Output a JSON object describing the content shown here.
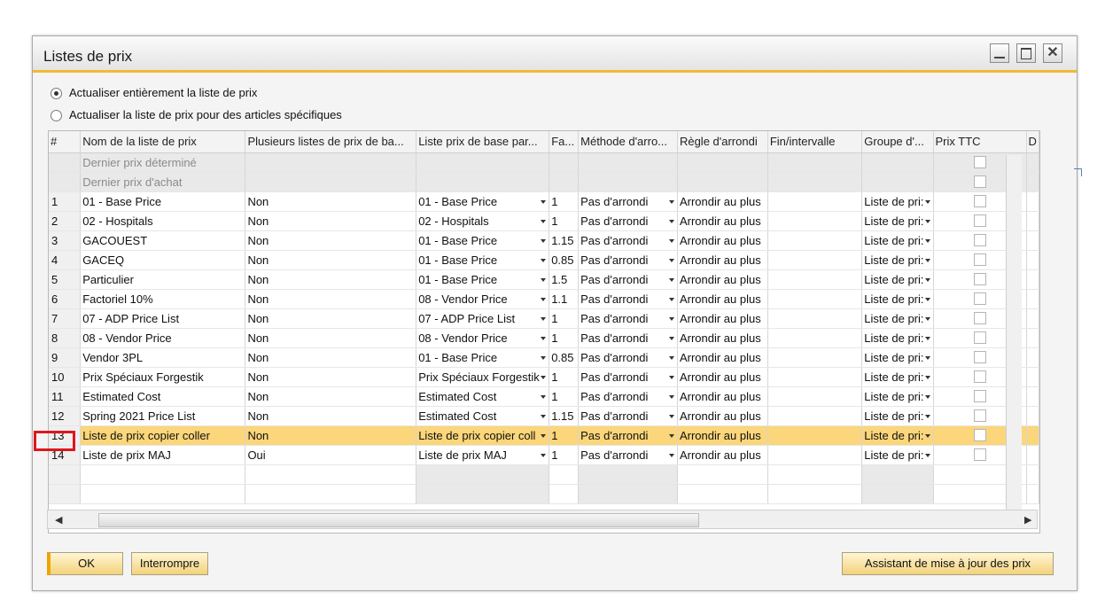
{
  "window": {
    "title": "Listes de prix"
  },
  "options": [
    {
      "label": "Actualiser entièrement la liste de prix",
      "selected": true
    },
    {
      "label": "Actualiser la liste de prix pour des articles spécifiques",
      "selected": false
    }
  ],
  "columns": [
    "#",
    "Nom de la liste de prix",
    "Plusieurs listes de prix de ba...",
    "Liste prix de base par...",
    "Fa...",
    "Méthode d'arro...",
    "Règle d'arrondi",
    "Fin/intervalle",
    "Groupe d'...",
    "Prix TTC",
    "D"
  ],
  "fixed_rows": [
    {
      "name": "Dernier prix déterminé"
    },
    {
      "name": "Dernier prix d'achat"
    }
  ],
  "rows": [
    {
      "num": "1",
      "name": "01 - Base Price",
      "multi": "Non",
      "base": "01 - Base Price",
      "factor": "1",
      "method": "Pas d'arrondi",
      "rule": "Arrondir au plus",
      "group": "Liste de pri:"
    },
    {
      "num": "2",
      "name": "02 - Hospitals",
      "multi": "Non",
      "base": "02 - Hospitals",
      "factor": "1",
      "method": "Pas d'arrondi",
      "rule": "Arrondir au plus",
      "group": "Liste de pri:"
    },
    {
      "num": "3",
      "name": "GACOUEST",
      "multi": "Non",
      "base": "01 - Base Price",
      "factor": "1.15",
      "method": "Pas d'arrondi",
      "rule": "Arrondir au plus",
      "group": "Liste de pri:"
    },
    {
      "num": "4",
      "name": "GACEQ",
      "multi": "Non",
      "base": "01 - Base Price",
      "factor": "0.85",
      "method": "Pas d'arrondi",
      "rule": "Arrondir au plus",
      "group": "Liste de pri:"
    },
    {
      "num": "5",
      "name": "Particulier",
      "multi": "Non",
      "base": "01 - Base Price",
      "factor": "1.5",
      "method": "Pas d'arrondi",
      "rule": "Arrondir au plus",
      "group": "Liste de pri:"
    },
    {
      "num": "6",
      "name": "Factoriel 10%",
      "multi": "Non",
      "base": "08 - Vendor Price",
      "factor": "1.1",
      "method": "Pas d'arrondi",
      "rule": "Arrondir au plus",
      "group": "Liste de pri:"
    },
    {
      "num": "7",
      "name": "07 - ADP Price List",
      "multi": "Non",
      "base": "07 - ADP Price List",
      "factor": "1",
      "method": "Pas d'arrondi",
      "rule": "Arrondir au plus",
      "group": "Liste de pri:"
    },
    {
      "num": "8",
      "name": "08 - Vendor Price",
      "multi": "Non",
      "base": "08 - Vendor Price",
      "factor": "1",
      "method": "Pas d'arrondi",
      "rule": "Arrondir au plus",
      "group": "Liste de pri:"
    },
    {
      "num": "9",
      "name": "Vendor 3PL",
      "multi": "Non",
      "base": "01 - Base Price",
      "factor": "0.85",
      "method": "Pas d'arrondi",
      "rule": "Arrondir au plus",
      "group": "Liste de pri:"
    },
    {
      "num": "10",
      "name": "Prix Spéciaux Forgestik",
      "multi": "Non",
      "base": "Prix Spéciaux Forgestik",
      "factor": "1",
      "method": "Pas d'arrondi",
      "rule": "Arrondir au plus",
      "group": "Liste de pri:"
    },
    {
      "num": "11",
      "name": "Estimated Cost",
      "multi": "Non",
      "base": "Estimated Cost",
      "factor": "1",
      "method": "Pas d'arrondi",
      "rule": "Arrondir au plus",
      "group": "Liste de pri:"
    },
    {
      "num": "12",
      "name": "Spring 2021 Price List",
      "multi": "Non",
      "base": "Estimated Cost",
      "factor": "1.15",
      "method": "Pas d'arrondi",
      "rule": "Arrondir au plus",
      "group": "Liste de pri:"
    },
    {
      "num": "13",
      "name": "Liste de prix copier coller",
      "multi": "Non",
      "base": "Liste de prix copier coll",
      "factor": "1",
      "method": "Pas d'arrondi",
      "rule": "Arrondir au plus",
      "group": "Liste de pri:",
      "selected": true
    },
    {
      "num": "14",
      "name": "Liste de prix MAJ",
      "multi": "Oui",
      "base": "Liste de prix MAJ",
      "factor": "1",
      "method": "Pas d'arrondi",
      "rule": "Arrondir au plus",
      "group": "Liste de pri:"
    }
  ],
  "buttons": {
    "ok": "OK",
    "cancel": "Interrompre",
    "wizard": "Assistant de mise à jour des prix"
  },
  "colors": {
    "accent": "#f5b930",
    "selected_row": "#fbd67a",
    "highlight_box": "#e0161b"
  }
}
